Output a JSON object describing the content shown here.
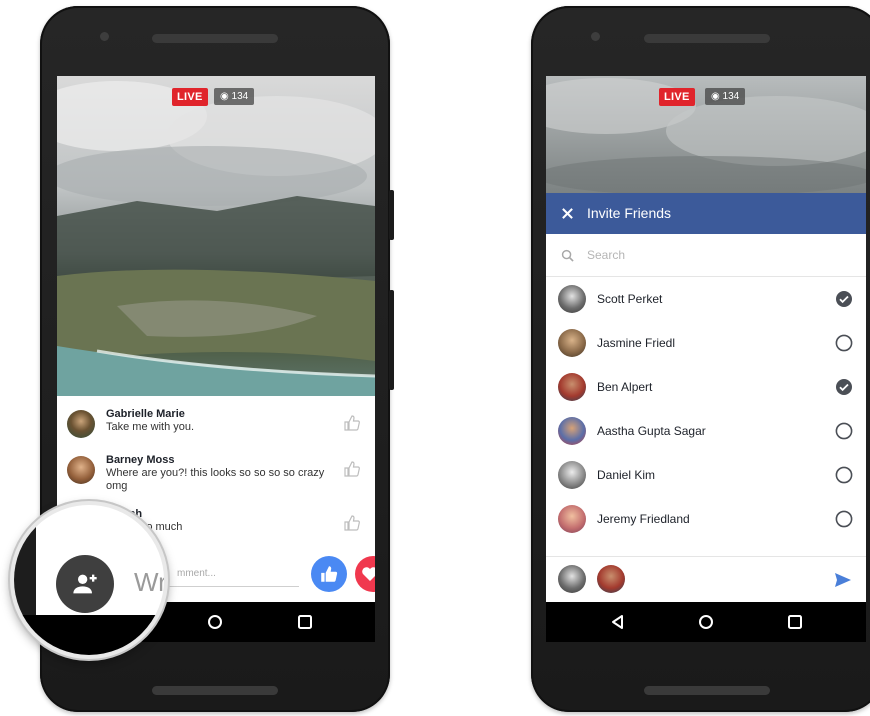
{
  "left_phone": {
    "live_label": "LIVE",
    "viewer_count": "134",
    "comments": [
      {
        "name": "Gabrielle Marie",
        "text": "Take me with you."
      },
      {
        "name": "Barney Moss",
        "text": "Where are you?! this looks so so so so crazy omg"
      },
      {
        "name": "e Shah",
        "text": "ve this so much"
      }
    ],
    "comment_placeholder_small": "mment...",
    "magnifier_write_text": "Wr"
  },
  "right_phone": {
    "live_label": "LIVE",
    "viewer_count": "134",
    "header_title": "Invite Friends",
    "search_placeholder": "Search",
    "friends": [
      {
        "name": "Scott Perket",
        "selected": true
      },
      {
        "name": "Jasmine Friedl",
        "selected": false
      },
      {
        "name": "Ben Alpert",
        "selected": true
      },
      {
        "name": "Aastha Gupta Sagar",
        "selected": false
      },
      {
        "name": "Daniel Kim",
        "selected": false
      },
      {
        "name": "Jeremy Friedland",
        "selected": false
      }
    ]
  },
  "icons": {
    "eye": "eye-icon",
    "like": "thumbs-up-icon",
    "heart": "heart-icon",
    "add_friend": "add-friend-icon",
    "close": "close-icon",
    "search": "search-icon",
    "send": "send-icon",
    "check": "checkmark-icon",
    "back": "back-triangle-icon",
    "home": "home-circle-icon",
    "recents": "recents-square-icon"
  },
  "colors": {
    "live_red": "#e0242b",
    "facebook_blue": "#3c5a9a",
    "like_blue": "#4a89f3",
    "heart_red": "#f0384e",
    "send_blue": "#4a7fd9"
  }
}
